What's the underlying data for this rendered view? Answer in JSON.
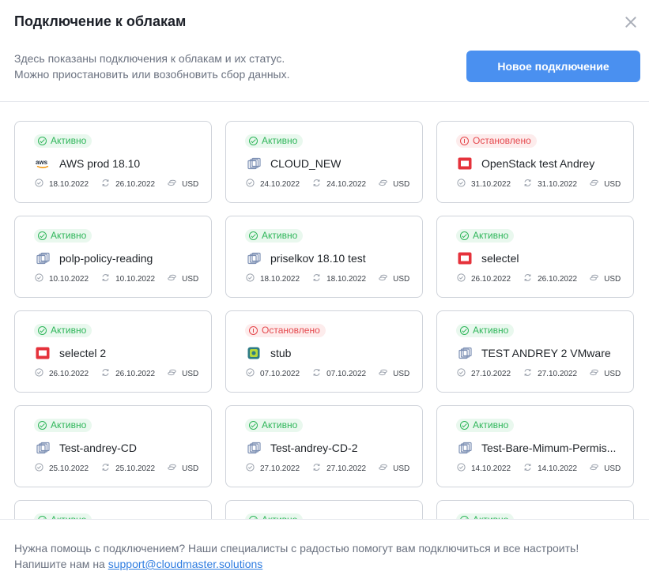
{
  "header": {
    "title": "Подключение к облакам",
    "description_line1": "Здесь показаны подключения к облакам и их статус.",
    "description_line2": "Можно приостановить или возобновить сбор данных.",
    "new_button_label": "Новое подключение"
  },
  "colors": {
    "accent": "#4a90f0",
    "active": "#2fb65a",
    "stopped": "#e5484d"
  },
  "cards": [
    {
      "status": "active",
      "status_label": "Активно",
      "provider_icon": "aws-icon",
      "name": "AWS prod 18.10",
      "created": "18.10.2022",
      "synced": "26.10.2022",
      "currency": "USD"
    },
    {
      "status": "active",
      "status_label": "Активно",
      "provider_icon": "vmware-icon",
      "name": "CLOUD_NEW",
      "created": "24.10.2022",
      "synced": "24.10.2022",
      "currency": "USD"
    },
    {
      "status": "stopped",
      "status_label": "Остановлено",
      "provider_icon": "openstack-icon",
      "name": "OpenStack test Andrey",
      "created": "31.10.2022",
      "synced": "31.10.2022",
      "currency": "USD"
    },
    {
      "status": "active",
      "status_label": "Активно",
      "provider_icon": "vmware-icon",
      "name": "polp-policy-reading",
      "created": "10.10.2022",
      "synced": "10.10.2022",
      "currency": "USD"
    },
    {
      "status": "active",
      "status_label": "Активно",
      "provider_icon": "vmware-icon",
      "name": "priselkov 18.10 test",
      "created": "18.10.2022",
      "synced": "18.10.2022",
      "currency": "USD"
    },
    {
      "status": "active",
      "status_label": "Активно",
      "provider_icon": "selectel-icon",
      "name": "selectel",
      "created": "26.10.2022",
      "synced": "26.10.2022",
      "currency": "USD"
    },
    {
      "status": "active",
      "status_label": "Активно",
      "provider_icon": "selectel-icon",
      "name": "selectel 2",
      "created": "26.10.2022",
      "synced": "26.10.2022",
      "currency": "USD"
    },
    {
      "status": "stopped",
      "status_label": "Остановлено",
      "provider_icon": "stub-icon",
      "name": "stub",
      "created": "07.10.2022",
      "synced": "07.10.2022",
      "currency": "USD"
    },
    {
      "status": "active",
      "status_label": "Активно",
      "provider_icon": "vmware-icon",
      "name": "TEST ANDREY 2 VMware",
      "created": "27.10.2022",
      "synced": "27.10.2022",
      "currency": "USD"
    },
    {
      "status": "active",
      "status_label": "Активно",
      "provider_icon": "vmware-icon",
      "name": "Test-andrey-CD",
      "created": "25.10.2022",
      "synced": "25.10.2022",
      "currency": "USD"
    },
    {
      "status": "active",
      "status_label": "Активно",
      "provider_icon": "vmware-icon",
      "name": "Test-andrey-CD-2",
      "created": "27.10.2022",
      "synced": "27.10.2022",
      "currency": "USD"
    },
    {
      "status": "active",
      "status_label": "Активно",
      "provider_icon": "vmware-icon",
      "name": "Test-Bare-Mimum-Permis...",
      "created": "14.10.2022",
      "synced": "14.10.2022",
      "currency": "USD"
    },
    {
      "status": "active",
      "status_label": "Активно",
      "provider_icon": "vmware-icon",
      "name": "",
      "created": "",
      "synced": "",
      "currency": ""
    },
    {
      "status": "active",
      "status_label": "Активно",
      "provider_icon": "vmware-icon",
      "name": "",
      "created": "",
      "synced": "",
      "currency": ""
    },
    {
      "status": "active",
      "status_label": "Активно",
      "provider_icon": "vmware-icon",
      "name": "",
      "created": "",
      "synced": "",
      "currency": ""
    }
  ],
  "footer": {
    "help_text": "Нужна помощь с подключением? Наши специалисты с радостью помогут вам подключиться и все настроить!",
    "write_prefix": "Напишите нам на ",
    "email": "support@cloudmaster.solutions"
  }
}
